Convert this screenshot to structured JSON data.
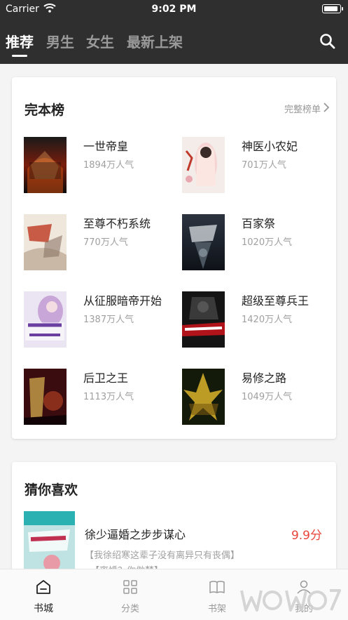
{
  "status_bar": {
    "carrier": "Carrier",
    "time": "9:02 PM"
  },
  "nav": {
    "tabs": [
      {
        "label": "推荐",
        "active": true
      },
      {
        "label": "男生",
        "active": false
      },
      {
        "label": "女生",
        "active": false
      },
      {
        "label": "最新上架",
        "active": false
      }
    ],
    "search_icon": "search-icon"
  },
  "ranking": {
    "title": "完本榜",
    "more_label": "完整榜单",
    "books": [
      {
        "title": "一世帝皇",
        "popularity": "1894万人气"
      },
      {
        "title": "神医小农妃",
        "popularity": "701万人气"
      },
      {
        "title": "至尊不朽系统",
        "popularity": "770万人气"
      },
      {
        "title": "百家祭",
        "popularity": "1020万人气"
      },
      {
        "title": "从征服暗帝开始",
        "popularity": "1387万人气"
      },
      {
        "title": "超级至尊兵王",
        "popularity": "1420万人气"
      },
      {
        "title": "后卫之王",
        "popularity": "1113万人气"
      },
      {
        "title": "易修之路",
        "popularity": "1049万人气"
      }
    ]
  },
  "recommend": {
    "title": "猜你喜欢",
    "book": {
      "title": "徐少逼婚之步步谋心",
      "score": "9.9分",
      "desc": "【我徐绍寒这辈子没有离异只有丧偶】",
      "desc2": "【离婚？你做梦】"
    }
  },
  "tabbar": {
    "items": [
      {
        "label": "书城",
        "icon": "bookstore-icon",
        "active": true
      },
      {
        "label": "分类",
        "icon": "category-grid-icon",
        "active": false
      },
      {
        "label": "书架",
        "icon": "bookshelf-icon",
        "active": false
      },
      {
        "label": "我的",
        "icon": "profile-icon",
        "active": false
      }
    ]
  },
  "colors": {
    "nav_bg": "#2f2f2f",
    "accent_red": "#e8453c",
    "muted": "#a0a0a0"
  }
}
